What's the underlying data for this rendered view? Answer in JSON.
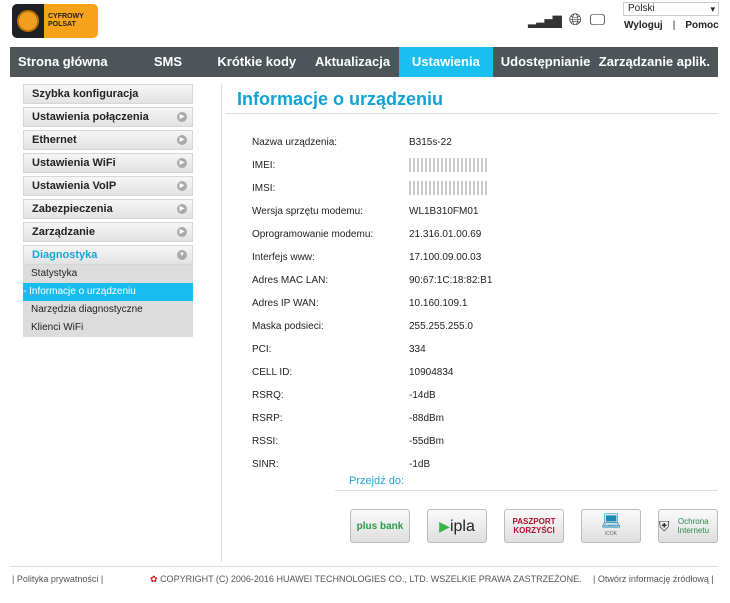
{
  "header": {
    "logo_text": [
      "CYFROWY",
      "POLSAT"
    ],
    "language": "Polski",
    "logout": "Wyloguj",
    "separator": "|",
    "help": "Pomoc"
  },
  "nav": [
    "Strona główna",
    "SMS",
    "Krótkie kody",
    "Aktualizacja",
    "Ustawienia",
    "Udostępnianie",
    "Zarządzanie aplik."
  ],
  "sidebar": {
    "items": [
      "Szybka konfiguracja",
      "Ustawienia połączenia",
      "Ethernet",
      "Ustawienia WiFi",
      "Ustawienia VoIP",
      "Zabezpieczenia",
      "Zarządzanie",
      "Diagnostyka"
    ],
    "sub": [
      "Statystyka",
      "- Informacje o urządzeniu",
      "Narzędzia diagnostyczne",
      "Klienci WiFi"
    ]
  },
  "main": {
    "title": "Informacje o urządzeniu",
    "rows": [
      {
        "k": "Nazwa urządzenia:",
        "v": "B315s-22"
      },
      {
        "k": "IMEI:",
        "v": ""
      },
      {
        "k": "IMSI:",
        "v": ""
      },
      {
        "k": "Wersja sprzętu modemu:",
        "v": "WL1B310FM01"
      },
      {
        "k": "Oprogramowanie modemu:",
        "v": "21.316.01.00.69"
      },
      {
        "k": "Interfejs www:",
        "v": "17.100.09.00.03"
      },
      {
        "k": "Adres MAC LAN:",
        "v": "90:67:1C:18:82:B1"
      },
      {
        "k": "Adres IP WAN:",
        "v": "10.160.109.1"
      },
      {
        "k": "Maska podsieci:",
        "v": "255.255.255.0"
      },
      {
        "k": "PCI:",
        "v": "334"
      },
      {
        "k": "CELL ID:",
        "v": "10904834"
      },
      {
        "k": "RSRQ:",
        "v": "-14dB"
      },
      {
        "k": "RSRP:",
        "v": "-88dBm"
      },
      {
        "k": "RSSI:",
        "v": "-55dBm"
      },
      {
        "k": "SINR:",
        "v": "-1dB"
      }
    ],
    "goto": "Przejdź do:",
    "shortcuts": [
      "plus bank",
      "ipla",
      "PASZPORT KORZYŚCI",
      "iCOK",
      "Ochrona Internetu"
    ]
  },
  "footer": {
    "privacy": "Polityka prywatności",
    "copyright": "COPYRIGHT (C) 2006-2016 HUAWEI TECHNOLOGIES CO., LTD. WSZELKIE PRAWA ZASTRZEŻONE.",
    "source": "Otwórz informację źródłową"
  }
}
